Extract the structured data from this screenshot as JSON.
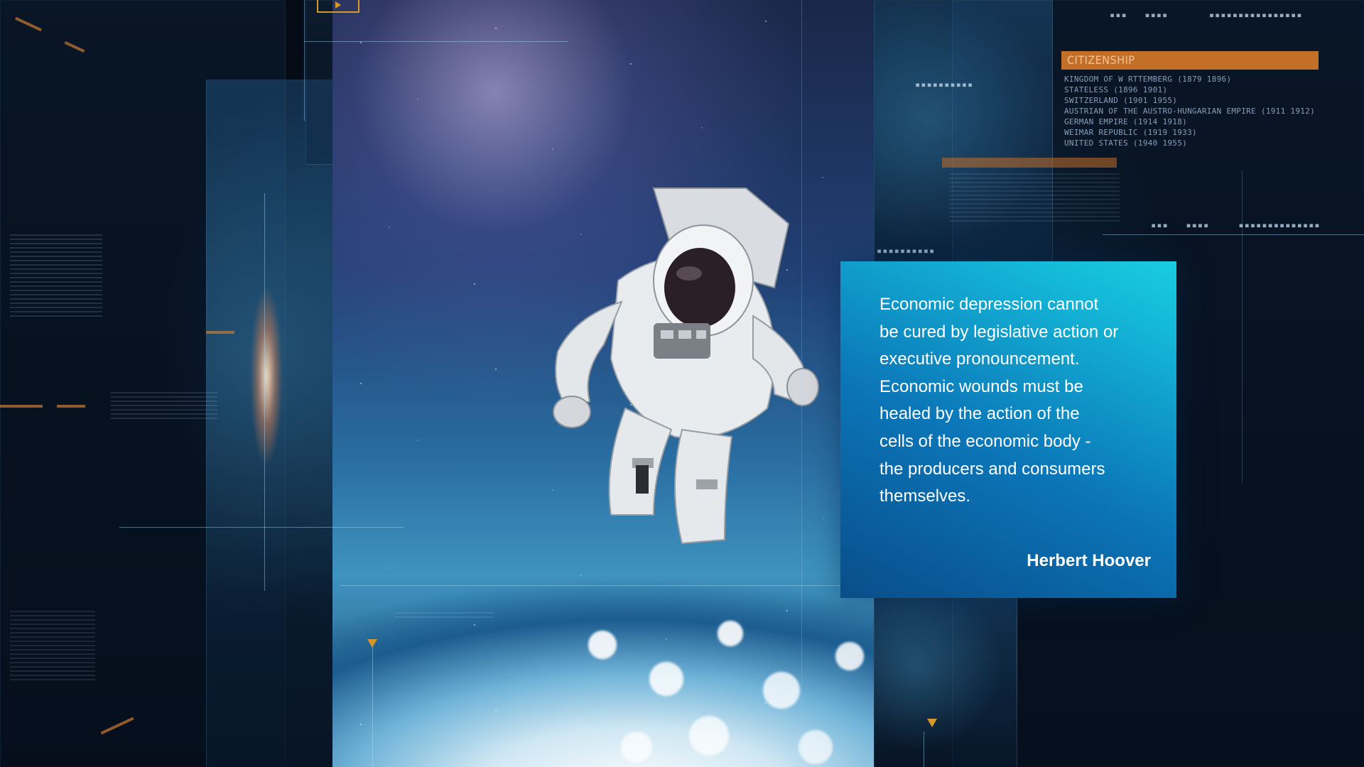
{
  "quote": {
    "text": "Economic depression cannot\nbe cured by legislative action or\nexecutive pronouncement.\nEconomic wounds must be\nhealed by the action of the\ncells of the economic body -\nthe producers and consumers\nthemselves.",
    "author": "Herbert Hoover"
  },
  "info_panel": {
    "header": "CITIZENSHIP",
    "items": [
      "KINGDOM OF W RTTEMBERG (1879 1896)",
      "STATELESS (1896 1901)",
      "SWITZERLAND (1901 1955)",
      "AUSTRIAN OF THE AUSTRO-HUNGARIAN EMPIRE (1911 1912)",
      "GERMAN EMPIRE (1914 1918)",
      "WEIMAR REPUBLIC (1919 1933)",
      "UNITED STATES (1940 1955)"
    ]
  },
  "colors": {
    "accent_orange": "#c46f28",
    "card_gradient_start": "#0a4d8a",
    "card_gradient_end": "#19cde0",
    "background": "#050c17"
  },
  "icons": {
    "play": "play-icon",
    "markers": "triangle-marker-icon"
  }
}
